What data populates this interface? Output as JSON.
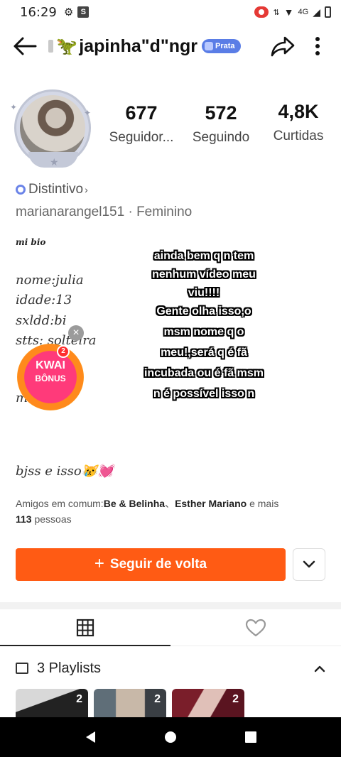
{
  "status_bar": {
    "time": "16:29",
    "network": "4G"
  },
  "header": {
    "username": "japinha\"d\"ngr",
    "level_badge": "Prata"
  },
  "stats": [
    {
      "value": "677",
      "label": "Seguidor..."
    },
    {
      "value": "572",
      "label": "Seguindo"
    },
    {
      "value": "4,8K",
      "label": "Curtidas"
    }
  ],
  "profile": {
    "badge_label": "Distintivo",
    "handle": "marianarangel151",
    "gender": "Feminino"
  },
  "bio": {
    "title": "mi bio",
    "lines": [
      "nome:julia",
      "idade:13",
      "sxldd:bi",
      "stts: solteira",
      "me"
    ],
    "signoff": "bjss e isso😿💓"
  },
  "overlay_text": {
    "line1": "ainda bem q n tem",
    "line2": "nenhum vídeo meu",
    "line3": "viu!!!!",
    "line4": "Gente olha isso,o",
    "line5": "msm nome q o",
    "line6": "meu!,será q é fã",
    "line7": "incubada ou é fã msm",
    "line8": "n é possível isso n"
  },
  "kwai_bonus": {
    "title": "KWAI",
    "subtitle": "BÔNUS",
    "count": "2"
  },
  "mutual_friends": {
    "prefix": "Amigos em comum:",
    "friend1": "Be & Belinha",
    "separator": "、",
    "friend2": "Esther Mariano",
    "middle": " e mais",
    "count": "113",
    "suffix": " pessoas"
  },
  "follow_button": {
    "label": "Seguir de volta"
  },
  "playlists": {
    "label": "3 Playlists"
  },
  "thumbnails": [
    {
      "count": "2"
    },
    {
      "count": "2"
    },
    {
      "count": "2"
    }
  ],
  "colors": {
    "accent": "#ff5b14",
    "badge": "#5a7de6"
  }
}
